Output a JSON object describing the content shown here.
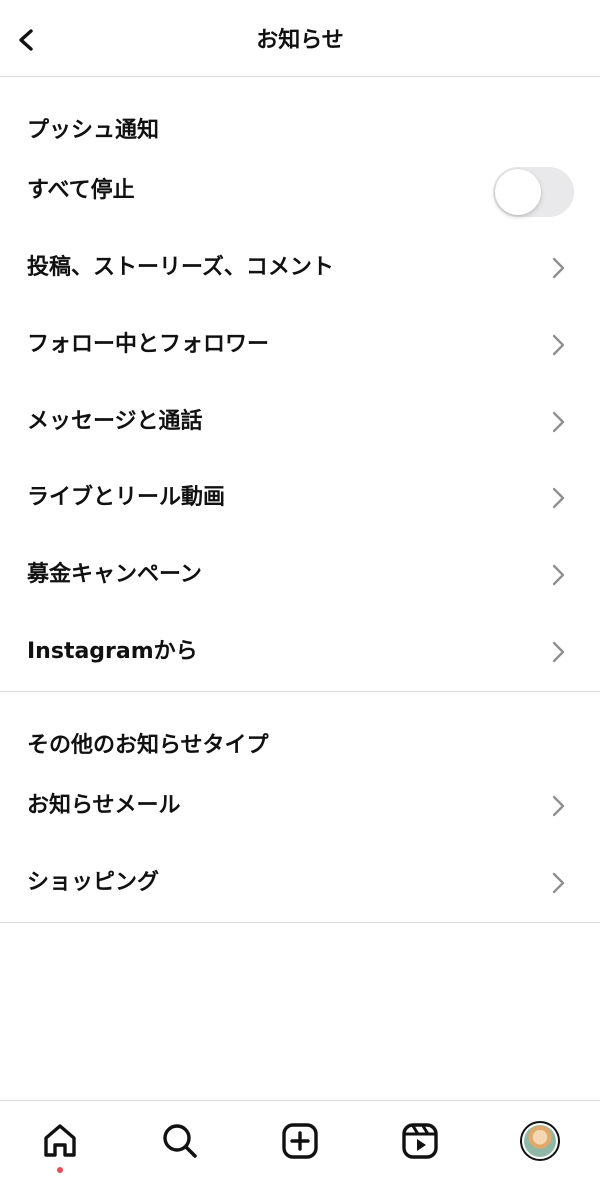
{
  "header": {
    "title": "お知らせ",
    "back_icon": "chevron-left-icon"
  },
  "push_section": {
    "title": "プッシュ通知",
    "pause_all": {
      "label": "すべて停止",
      "toggle_on": false
    },
    "items": [
      {
        "label": "投稿、ストーリーズ、コメント"
      },
      {
        "label": "フォロー中とフォロワー"
      },
      {
        "label": "メッセージと通話"
      },
      {
        "label": "ライブとリール動画"
      },
      {
        "label": "募金キャンペーン"
      },
      {
        "label": "Instagramから"
      }
    ]
  },
  "other_section": {
    "title": "その他のお知らせタイプ",
    "items": [
      {
        "label": "お知らせメール"
      },
      {
        "label": "ショッピング"
      }
    ]
  },
  "tabbar": {
    "tabs": [
      {
        "name": "home-icon",
        "has_notification_dot": true
      },
      {
        "name": "search-icon"
      },
      {
        "name": "create-post-icon"
      },
      {
        "name": "reels-icon"
      },
      {
        "name": "profile-avatar"
      }
    ]
  },
  "colors": {
    "toggle_off_track": "#e9e9eb",
    "divider": "#dbdbdb",
    "notification_dot": "#ed4956",
    "chevron": "#8e8e8e"
  }
}
